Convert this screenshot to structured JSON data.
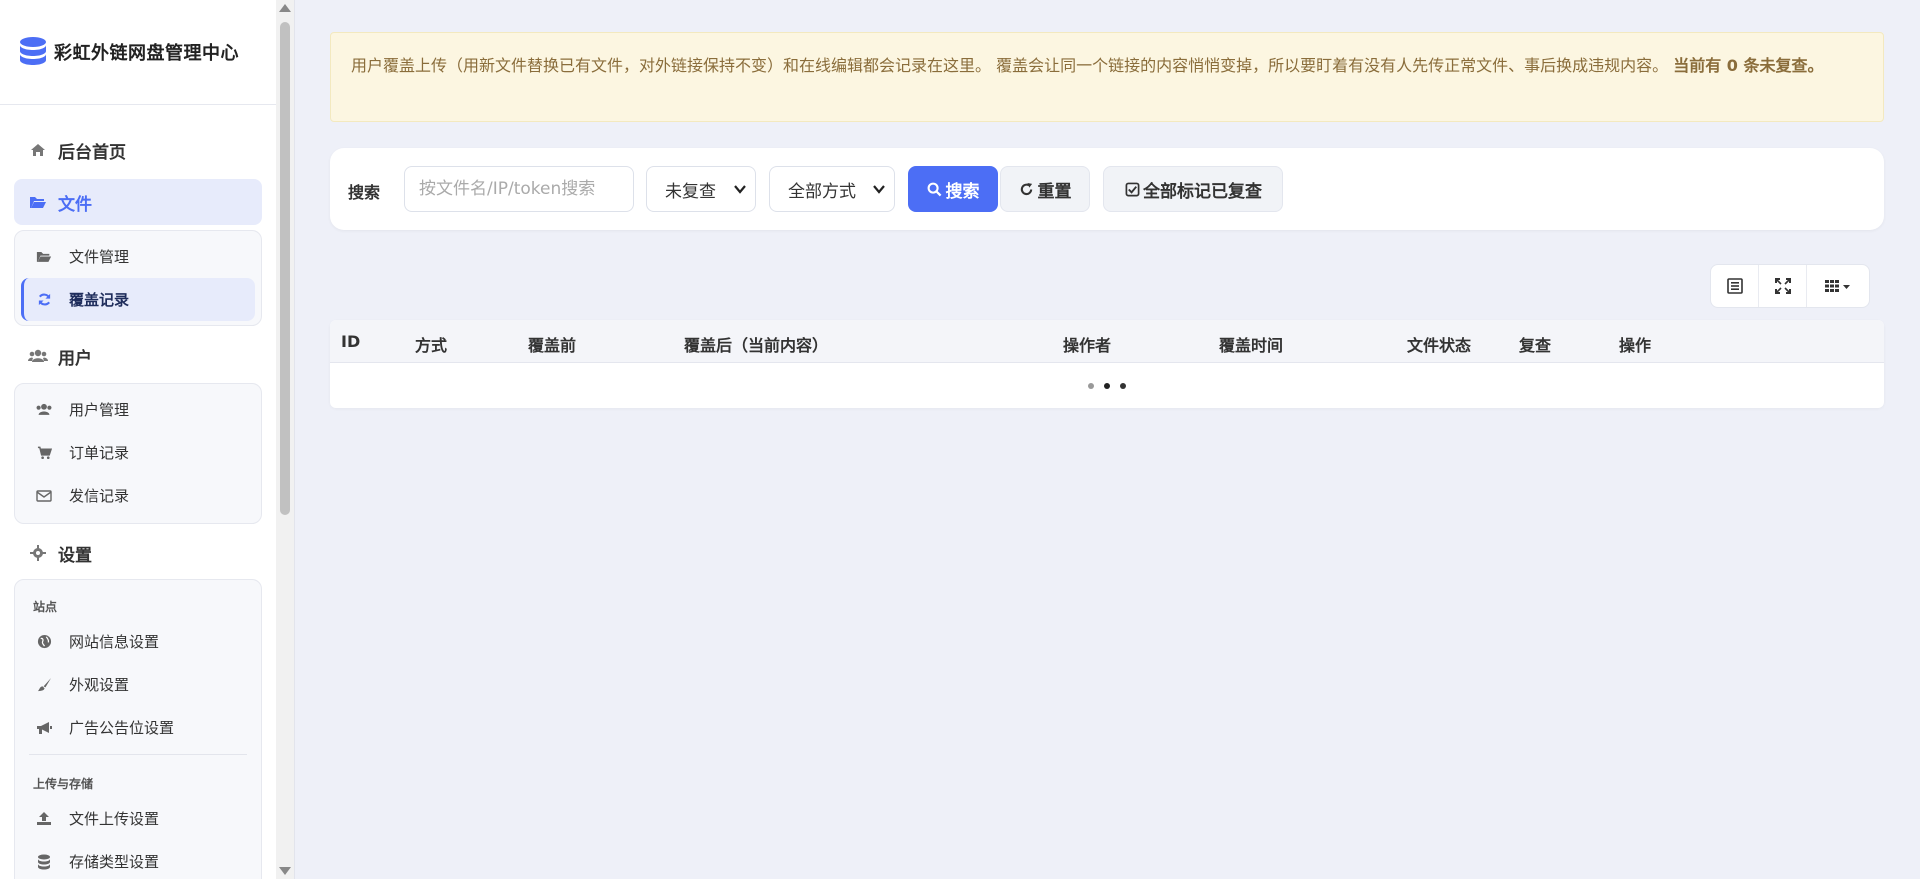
{
  "brand": {
    "name": "彩虹外链网盘管理中心"
  },
  "nav": {
    "home": {
      "label": "后台首页",
      "icon": "home-icon"
    },
    "files": {
      "label": "文件",
      "icon": "folder-open-icon",
      "items": [
        {
          "label": "文件管理",
          "icon": "folder-open-icon"
        },
        {
          "label": "覆盖记录",
          "icon": "refresh-icon"
        }
      ]
    },
    "users": {
      "label": "用户",
      "icon": "users-icon",
      "items": [
        {
          "label": "用户管理",
          "icon": "users-icon"
        },
        {
          "label": "订单记录",
          "icon": "cart-icon"
        },
        {
          "label": "发信记录",
          "icon": "envelope-icon"
        }
      ]
    },
    "settings": {
      "label": "设置",
      "icon": "gear-icon",
      "section_site": "站点",
      "site_items": [
        {
          "label": "网站信息设置",
          "icon": "globe-icon"
        },
        {
          "label": "外观设置",
          "icon": "paint-brush-icon"
        },
        {
          "label": "广告公告位设置",
          "icon": "bullhorn-icon"
        }
      ],
      "section_upload": "上传与存储",
      "upload_items": [
        {
          "label": "文件上传设置",
          "icon": "upload-icon"
        },
        {
          "label": "存储类型设置",
          "icon": "database-icon"
        }
      ]
    }
  },
  "alert": {
    "text": "用户覆盖上传（用新文件替换已有文件，对外链接保持不变）和在线编辑都会记录在这里。 覆盖会让同一个链接的内容悄悄变掉，所以要盯着有没有人先传正常文件、事后换成违规内容。",
    "strong_text": "当前有 0 条未复查。"
  },
  "search": {
    "label": "搜索",
    "placeholder": "按文件名/IP/token搜索",
    "review_filter": "未复查",
    "method_filter": "全部方式",
    "search_button": "搜索",
    "reset_button": "重置",
    "mark_all_button": "全部标记已复查"
  },
  "table": {
    "columns": [
      "ID",
      "方式",
      "覆盖前",
      "覆盖后（当前内容）",
      "操作者",
      "覆盖时间",
      "文件状态",
      "复查",
      "操作"
    ]
  },
  "colors": {
    "primary": "#4c6ef5",
    "alert_bg": "#fcf6e1",
    "alert_text": "#8a6d3b",
    "page_bg": "#eef0f8"
  }
}
